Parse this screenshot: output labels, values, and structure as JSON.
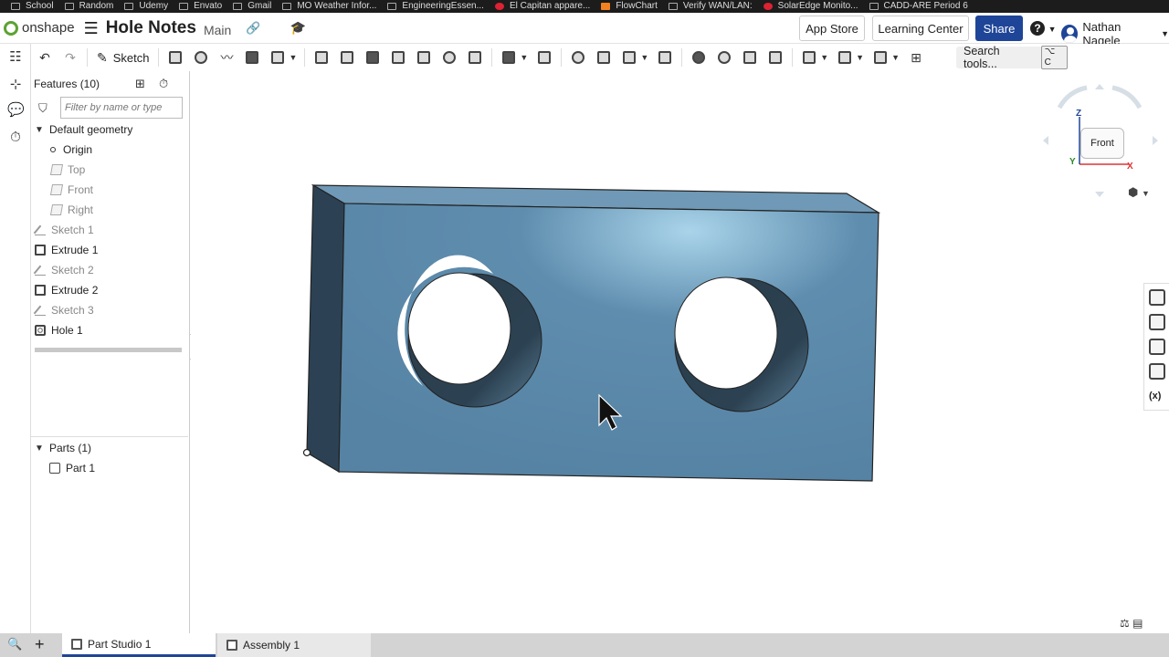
{
  "bookmarks": [
    "School",
    "Random",
    "Udemy",
    "Envato",
    "Gmail",
    "MO Weather Infor...",
    "EngineeringEssen...",
    "El Capitan appare...",
    "FlowChart",
    "Verify WAN/LAN:",
    "SolarEdge Monito...",
    "CADD-ARE Period 6"
  ],
  "header": {
    "logo": "onshape",
    "doc_title": "Hole Notes",
    "branch": "Main",
    "app_store": "App Store",
    "learning_center": "Learning Center",
    "share": "Share",
    "help": "?",
    "user": "Nathan Nagele"
  },
  "toolbar": {
    "sketch": "Sketch",
    "search_tools": "Search tools...",
    "search_shortcut": "⌥ C"
  },
  "features": {
    "title": "Features (10)",
    "filter_placeholder": "Filter by name or type",
    "default_geometry": "Default geometry",
    "items": [
      {
        "label": "Origin"
      },
      {
        "label": "Top"
      },
      {
        "label": "Front"
      },
      {
        "label": "Right"
      },
      {
        "label": "Sketch 1"
      },
      {
        "label": "Extrude 1"
      },
      {
        "label": "Sketch 2"
      },
      {
        "label": "Extrude 2"
      },
      {
        "label": "Sketch 3"
      },
      {
        "label": "Hole 1"
      }
    ],
    "parts_header": "Parts (1)",
    "parts": [
      {
        "label": "Part 1"
      }
    ]
  },
  "viewcube": {
    "face": "Front",
    "axis_z": "Z",
    "axis_x": "X",
    "axis_y": "Y"
  },
  "tabs": [
    {
      "label": "Part Studio 1"
    },
    {
      "label": "Assembly 1"
    }
  ],
  "colors": {
    "model_front": "#5a86a6",
    "model_side": "#2f4a5d",
    "model_top": "#6e98b5",
    "accent": "#1f4598",
    "logo_green": "#5ca332"
  }
}
